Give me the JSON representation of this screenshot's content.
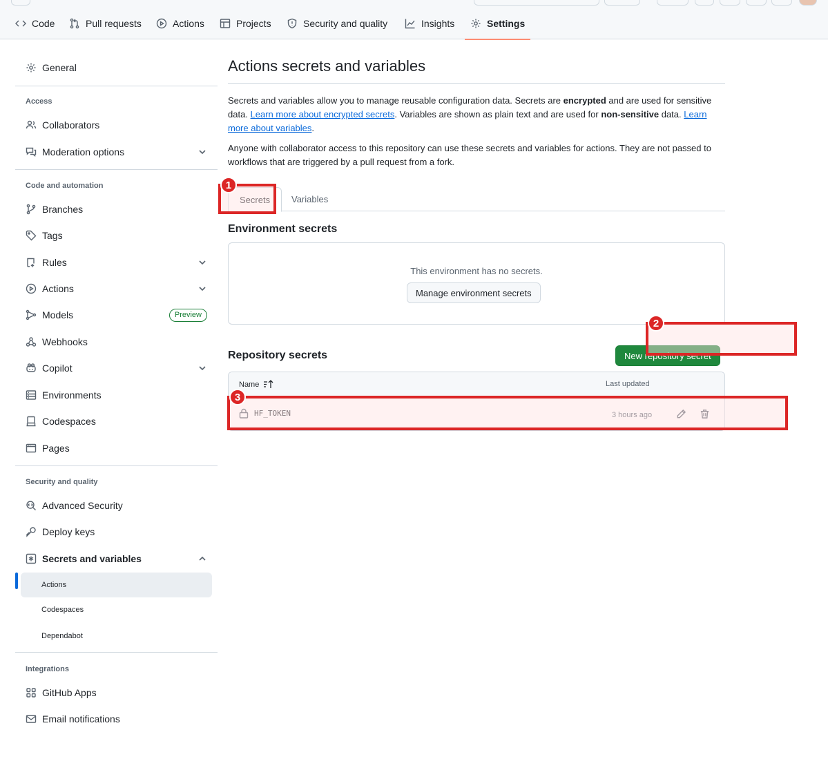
{
  "repo_nav": {
    "tabs": [
      {
        "label": "Code",
        "icon": "code-icon"
      },
      {
        "label": "Pull requests",
        "icon": "git-pull-request-icon"
      },
      {
        "label": "Actions",
        "icon": "play-icon"
      },
      {
        "label": "Projects",
        "icon": "table-icon"
      },
      {
        "label": "Security and quality",
        "icon": "shield-icon"
      },
      {
        "label": "Insights",
        "icon": "graph-icon"
      },
      {
        "label": "Settings",
        "icon": "gear-icon",
        "selected": true
      }
    ]
  },
  "sidebar": {
    "general": "General",
    "sections": {
      "access": "Access",
      "code_automation": "Code and automation",
      "security": "Security and quality",
      "integrations": "Integrations"
    },
    "items": {
      "collaborators": "Collaborators",
      "moderation": "Moderation options",
      "branches": "Branches",
      "tags": "Tags",
      "rules": "Rules",
      "actions": "Actions",
      "models": "Models",
      "models_badge": "Preview",
      "webhooks": "Webhooks",
      "copilot": "Copilot",
      "environments": "Environments",
      "codespaces": "Codespaces",
      "pages": "Pages",
      "advanced_security": "Advanced Security",
      "deploy_keys": "Deploy keys",
      "secrets_variables": "Secrets and variables",
      "github_apps": "GitHub Apps",
      "email_notifications": "Email notifications"
    },
    "secrets_sub": {
      "actions": "Actions",
      "codespaces": "Codespaces",
      "dependabot": "Dependabot"
    }
  },
  "main": {
    "title": "Actions secrets and variables",
    "intro_1a": "Secrets and variables allow you to manage reusable configuration data. Secrets are ",
    "intro_1b": "encrypted",
    "intro_1c": " and are used for sensitive data. ",
    "intro_link_1": "Learn more about encrypted secrets",
    "intro_1d": ". Variables are shown as plain text and are used for ",
    "intro_1e": "non-sensitive",
    "intro_1f": " data. ",
    "intro_link_2": "Learn more about variables",
    "intro_1g": ".",
    "intro_2": "Anyone with collaborator access to this repository can use these secrets and variables for actions. They are not passed to workflows that are triggered by a pull request from a fork.",
    "tabs": {
      "secrets": "Secrets",
      "variables": "Variables"
    },
    "env_title": "Environment secrets",
    "env_empty": "This environment has no secrets.",
    "env_button": "Manage environment secrets",
    "repo_title": "Repository secrets",
    "new_button": "New repository secret",
    "table": {
      "col_name": "Name",
      "col_updated": "Last updated",
      "rows": [
        {
          "name": "HF_TOKEN",
          "updated": "3 hours ago"
        }
      ]
    }
  },
  "annotations": {
    "marks": [
      "1",
      "2",
      "3"
    ],
    "color": "#dc2626"
  },
  "colors": {
    "accent_link": "#0969da",
    "primary_button": "#1f883d",
    "selected_underline": "#fd8c73"
  }
}
